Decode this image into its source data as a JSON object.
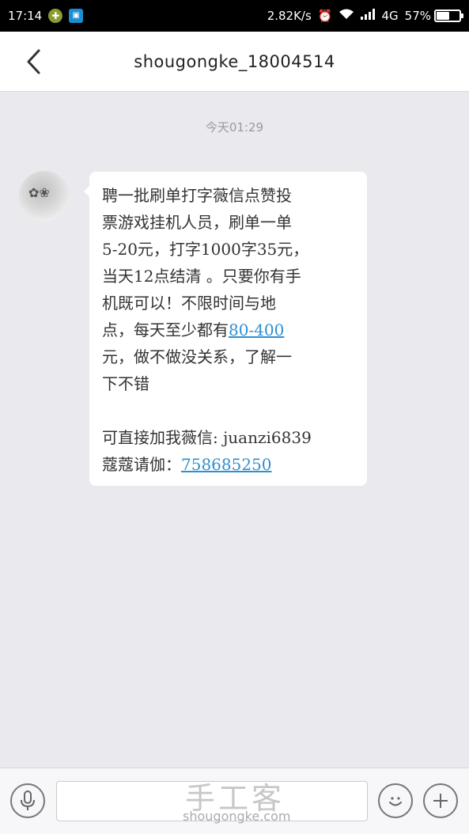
{
  "status_bar": {
    "time": "17:14",
    "speed": "2.82K/s",
    "network": "4G",
    "battery_percent": "57%",
    "battery_level": 0.57
  },
  "nav": {
    "title": "shougongke_18004514"
  },
  "chat": {
    "timestamp": "今天01:29",
    "message": {
      "lines": [
        "聘一批刷单打字薇信点赞投",
        "票游戏挂机人员，刷单一单",
        "5-20元，打字1000字35元，",
        "当天12点结清 。只要你有手",
        "机既可以！不限时间与地",
        "点，每天至少都有",
        "元，做不做没关系，了解一",
        "下不错",
        "可直接加我薇信: juanzi6839",
        "蔻蔻请伽："
      ],
      "amount_link": "80-400",
      "qq_link": "758685250"
    }
  },
  "watermark": {
    "main": "手工客",
    "sub": "shougongke.com"
  },
  "icons": {
    "back": "chevron-left-icon",
    "mic": "microphone-icon",
    "emoji": "smiley-icon",
    "plus": "plus-icon"
  }
}
